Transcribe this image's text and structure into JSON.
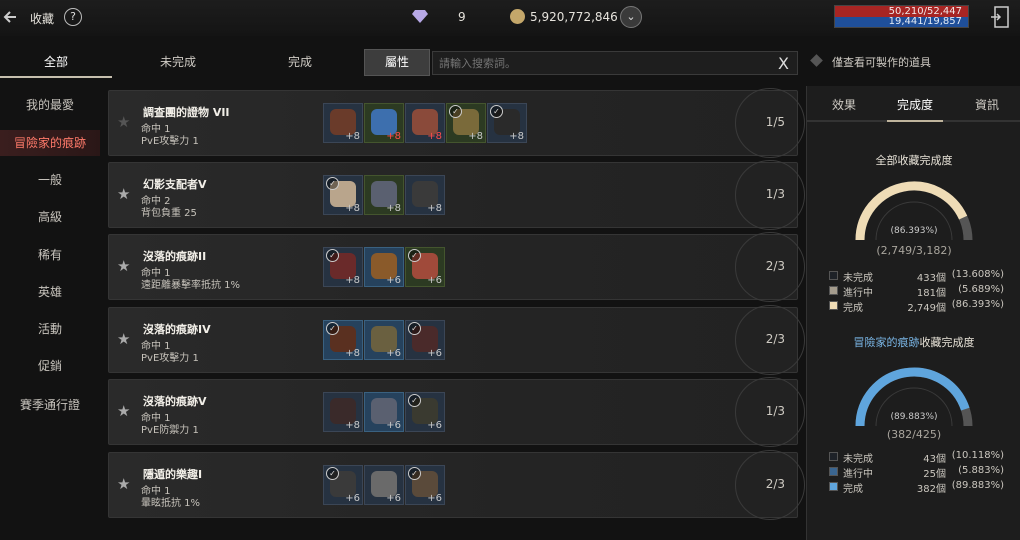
{
  "topbar": {
    "back_label": "收藏",
    "gems": "9",
    "gold": "5,920,772,846",
    "hp": "50,210/52,447",
    "mp": "19,441/19,857"
  },
  "tabs": [
    "全部",
    "未完成",
    "完成",
    "屬性"
  ],
  "search": {
    "placeholder": "請輸入搜索詞。",
    "clear": "X"
  },
  "filter_label": "僅查看可製作的道具",
  "sidebar": [
    "我的最愛",
    "冒險家的痕跡",
    "一般",
    "高級",
    "稀有",
    "英雄",
    "活動",
    "促銷",
    "賽季通行證"
  ],
  "rows": [
    {
      "name": "調查團的證物 VII",
      "s1": "命中 1",
      "s2": "PvE攻擊力 1",
      "progress": "1/5",
      "starred": false,
      "slots": [
        {
          "bg": "",
          "plus": "+8",
          "red": false,
          "chk": false,
          "color": "#6a3b2a"
        },
        {
          "bg": "g",
          "plus": "+8",
          "red": true,
          "chk": false,
          "color": "#3d6fae"
        },
        {
          "bg": "",
          "plus": "+8",
          "red": true,
          "chk": false,
          "color": "#8a4a3a"
        },
        {
          "bg": "g",
          "plus": "+8",
          "red": false,
          "chk": true,
          "color": "#7a6a3a"
        },
        {
          "bg": "",
          "plus": "+8",
          "red": false,
          "chk": true,
          "color": "#2a2a2a"
        }
      ]
    },
    {
      "name": "幻影支配者V",
      "s1": "命中 2",
      "s2": "背包負重 25",
      "progress": "1/3",
      "starred": true,
      "slots": [
        {
          "bg": "",
          "plus": "+8",
          "red": false,
          "chk": true,
          "color": "#b9a58c"
        },
        {
          "bg": "g",
          "plus": "+8",
          "red": false,
          "chk": false,
          "color": "#5a6070"
        },
        {
          "bg": "",
          "plus": "+8",
          "red": false,
          "chk": false,
          "color": "#3a3a3a"
        }
      ]
    },
    {
      "name": "沒落的痕跡II",
      "s1": "命中 1",
      "s2": "遠距離暴擊率抵抗 1%",
      "progress": "2/3",
      "starred": true,
      "slots": [
        {
          "bg": "",
          "plus": "+8",
          "red": false,
          "chk": true,
          "color": "#6a2a2a"
        },
        {
          "bg": "b",
          "plus": "+6",
          "red": false,
          "chk": false,
          "color": "#8a5a2a"
        },
        {
          "bg": "g",
          "plus": "+6",
          "red": false,
          "chk": true,
          "color": "#a04a3a"
        }
      ]
    },
    {
      "name": "沒落的痕跡IV",
      "s1": "命中 1",
      "s2": "PvE攻擊力 1",
      "progress": "2/3",
      "starred": true,
      "slots": [
        {
          "bg": "b",
          "plus": "+8",
          "red": false,
          "chk": true,
          "color": "#5a3020"
        },
        {
          "bg": "b",
          "plus": "+6",
          "red": false,
          "chk": false,
          "color": "#6a6040"
        },
        {
          "bg": "",
          "plus": "+6",
          "red": false,
          "chk": true,
          "color": "#4a2a2a"
        }
      ]
    },
    {
      "name": "沒落的痕跡V",
      "s1": "命中 1",
      "s2": "PvE防禦力 1",
      "progress": "1/3",
      "starred": true,
      "slots": [
        {
          "bg": "",
          "plus": "+8",
          "red": false,
          "chk": false,
          "color": "#3a2a2a"
        },
        {
          "bg": "b",
          "plus": "+6",
          "red": false,
          "chk": false,
          "color": "#5a6070"
        },
        {
          "bg": "",
          "plus": "+6",
          "red": false,
          "chk": true,
          "color": "#3a3a30"
        }
      ]
    },
    {
      "name": "隱遁的樂趣I",
      "s1": "命中 1",
      "s2": "暈眩抵抗 1%",
      "progress": "2/3",
      "starred": true,
      "slots": [
        {
          "bg": "",
          "plus": "+6",
          "red": false,
          "chk": true,
          "color": "#3a3a3a"
        },
        {
          "bg": "",
          "plus": "+6",
          "red": false,
          "chk": false,
          "color": "#6a6a6a"
        },
        {
          "bg": "",
          "plus": "+6",
          "red": false,
          "chk": true,
          "color": "#5a4a3a"
        }
      ]
    }
  ],
  "panel": {
    "tabs": [
      "效果",
      "完成度",
      "資訊"
    ],
    "overall": {
      "title": "全部收藏完成度",
      "pct_text": "(86.393%)",
      "count_text": "(2,749/3,182)",
      "fill": 0.86393,
      "color": "#efdcb6",
      "legend": [
        {
          "label": "未完成",
          "count": "433個",
          "pct": "(13.608%)",
          "color": "#1e2228"
        },
        {
          "label": "進行中",
          "count": "181個",
          "pct": "(5.689%)",
          "color": "#a59c8d"
        },
        {
          "label": "完成",
          "count": "2,749個",
          "pct": "(86.393%)",
          "color": "#efdcb6"
        }
      ]
    },
    "adv": {
      "title": "冒險家的痕跡",
      "title_suffix": "收藏完成度",
      "pct_text": "(89.883%)",
      "count_text": "(382/425)",
      "fill": 0.89883,
      "color": "#5fa5dd",
      "legend": [
        {
          "label": "未完成",
          "count": "43個",
          "pct": "(10.118%)",
          "color": "#1e2228"
        },
        {
          "label": "進行中",
          "count": "25個",
          "pct": "(5.883%)",
          "color": "#3a6590"
        },
        {
          "label": "完成",
          "count": "382個",
          "pct": "(89.883%)",
          "color": "#5fa5dd"
        }
      ]
    }
  }
}
